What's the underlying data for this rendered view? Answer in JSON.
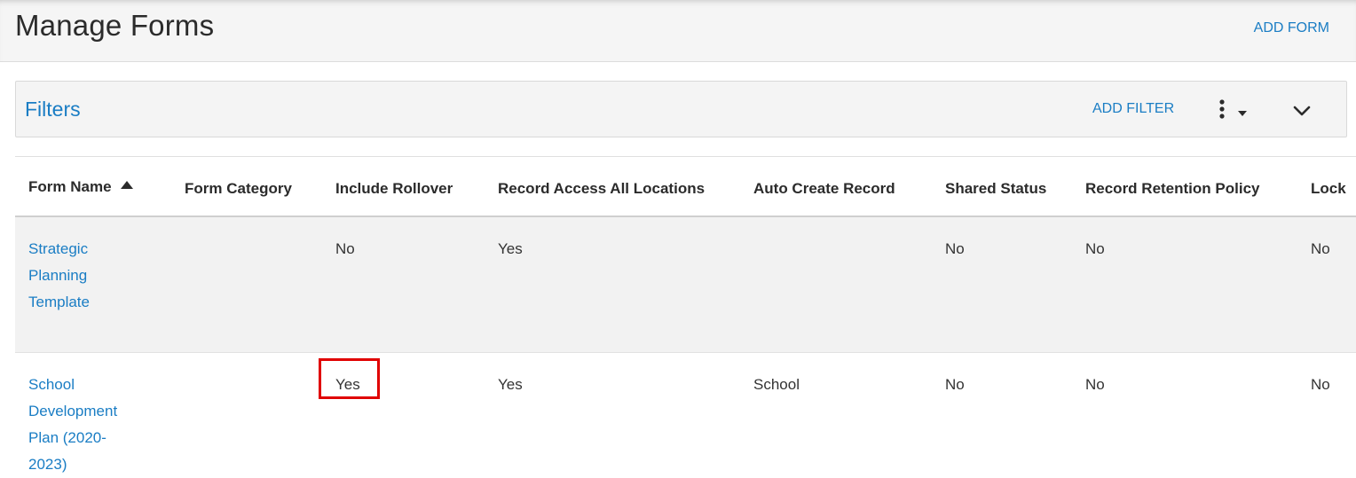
{
  "header": {
    "title": "Manage Forms",
    "add_form_label": "ADD FORM"
  },
  "filters": {
    "title": "Filters",
    "add_filter_label": "ADD FILTER",
    "more_icon": "vertical-ellipsis-dropdown-icon",
    "collapse_icon": "chevron-down-icon"
  },
  "table": {
    "columns": [
      "Form Name",
      "Form Category",
      "Include Rollover",
      "Record Access All Locations",
      "Auto Create Record",
      "Shared Status",
      "Record Retention Policy",
      "Lock"
    ],
    "sort": {
      "column": "Form Name",
      "direction": "ascending"
    },
    "rows": [
      {
        "form_name": "Strategic Planning Template",
        "form_category": "",
        "include_rollover": "No",
        "record_access_all_locations": "Yes",
        "auto_create_record": "",
        "shared_status": "No",
        "record_retention_policy": "No",
        "lock": "No"
      },
      {
        "form_name": "School Development Plan (2020-2023)",
        "form_category": "",
        "include_rollover": "Yes",
        "record_access_all_locations": "Yes",
        "auto_create_record": "School",
        "shared_status": "No",
        "record_retention_policy": "No",
        "lock": "No"
      }
    ]
  },
  "colors": {
    "link": "#1a7dc4",
    "highlight": "#e00000",
    "striped_row": "#f2f2f2"
  }
}
